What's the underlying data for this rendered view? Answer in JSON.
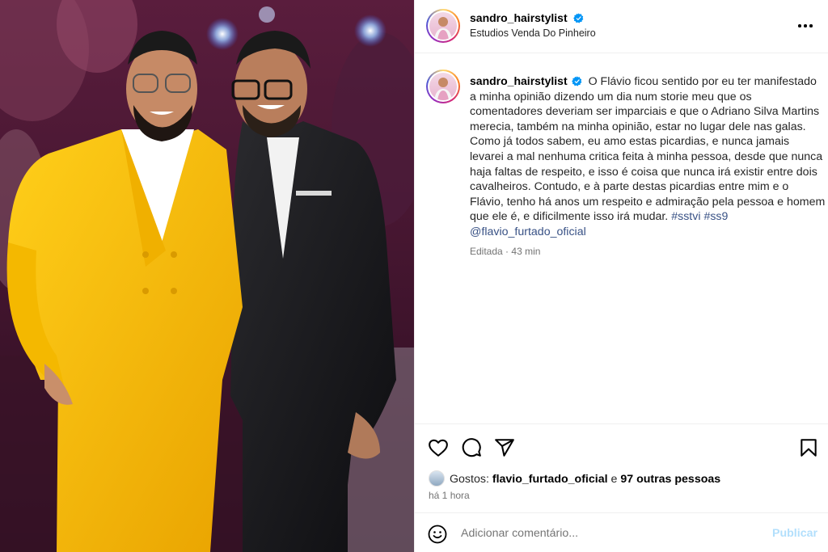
{
  "post": {
    "author": {
      "username": "sandro_hairstylist",
      "verified": true,
      "location": "Estudios Venda Do Pinheiro"
    },
    "caption": {
      "username": "sandro_hairstylist",
      "text": "O Flávio ficou sentido por eu ter manifestado a minha opinião dizendo um dia num storie meu que os comentadores deveriam ser imparciais e que o Adriano Silva Martins merecia, também na minha opinião, estar no lugar dele nas galas. Como já todos sabem, eu amo estas picardias, e nunca jamais levarei a mal nenhuma critica feita à minha pessoa, desde que nunca haja faltas de respeito, e isso é coisa que nunca irá existir entre dois cavalheiros. Contudo, e à parte destas picardias entre mim e o Flávio, tenho há anos um respeito e admiração pela pessoa e homem que ele é, e dificilmente isso irá mudar.",
      "hashtags": [
        "#sstvi",
        "#ss9"
      ],
      "mention": "@flavio_furtado_oficial",
      "edited_label": "Editada",
      "separator": "·",
      "age": "43 min"
    },
    "likes": {
      "prefix": "Gostos:",
      "first_user": "flavio_furtado_oficial",
      "conjunction": "e",
      "others": "97 outras pessoas"
    },
    "timestamp": "há 1 hora",
    "comment": {
      "placeholder": "Adicionar comentário...",
      "publish_label": "Publicar"
    }
  },
  "icons": {
    "more": "more-horizontal-icon",
    "like": "heart-icon",
    "comment": "comment-bubble-icon",
    "share": "paper-plane-icon",
    "save": "bookmark-icon",
    "emoji": "smiley-icon",
    "verified": "verified-badge-icon"
  },
  "colors": {
    "verified_blue": "#0095f6",
    "hashtag_link": "#385185",
    "publish_disabled": "#b2dffc",
    "secondary_text": "#737373",
    "yellow_suit": "#f4b800"
  }
}
